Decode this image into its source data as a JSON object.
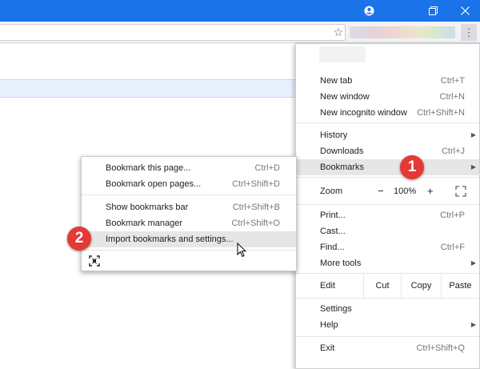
{
  "titlebar": {
    "color": "#1a73e8",
    "icons": [
      "account-icon",
      "restore-icon",
      "close-icon"
    ]
  },
  "toolbar": {
    "star": "☆",
    "menu_glyph": "⋮"
  },
  "chrome_menu": {
    "items": [
      {
        "label": "New tab",
        "shortcut": "Ctrl+T"
      },
      {
        "label": "New window",
        "shortcut": "Ctrl+N"
      },
      {
        "label": "New incognito window",
        "shortcut": "Ctrl+Shift+N"
      },
      {
        "label": "History",
        "arrow": "▶"
      },
      {
        "label": "Downloads",
        "shortcut": "Ctrl+J"
      },
      {
        "label": "Bookmarks",
        "arrow": "▶"
      },
      {
        "label": "Print...",
        "shortcut": "Ctrl+P"
      },
      {
        "label": "Cast..."
      },
      {
        "label": "Find...",
        "shortcut": "Ctrl+F"
      },
      {
        "label": "More tools",
        "arrow": "▶"
      },
      {
        "label": "Settings"
      },
      {
        "label": "Help",
        "arrow": "▶"
      },
      {
        "label": "Exit",
        "shortcut": "Ctrl+Shift+Q"
      }
    ],
    "zoom": {
      "label": "Zoom",
      "minus": "−",
      "value": "100%",
      "plus": "+"
    },
    "edit": {
      "label": "Edit",
      "cut": "Cut",
      "copy": "Copy",
      "paste": "Paste"
    }
  },
  "bookmarks_submenu": {
    "items": [
      {
        "label": "Bookmark this page...",
        "shortcut": "Ctrl+D"
      },
      {
        "label": "Bookmark open pages...",
        "shortcut": "Ctrl+Shift+D"
      },
      {
        "label": "Show bookmarks bar",
        "shortcut": "Ctrl+Shift+B"
      },
      {
        "label": "Bookmark manager",
        "shortcut": "Ctrl+Shift+O"
      },
      {
        "label": "Import bookmarks and settings..."
      }
    ],
    "bottom_icon": "bookmark-app-icon"
  },
  "annotations": {
    "step1": "1",
    "step2": "2",
    "badge_color": "#e53935"
  }
}
